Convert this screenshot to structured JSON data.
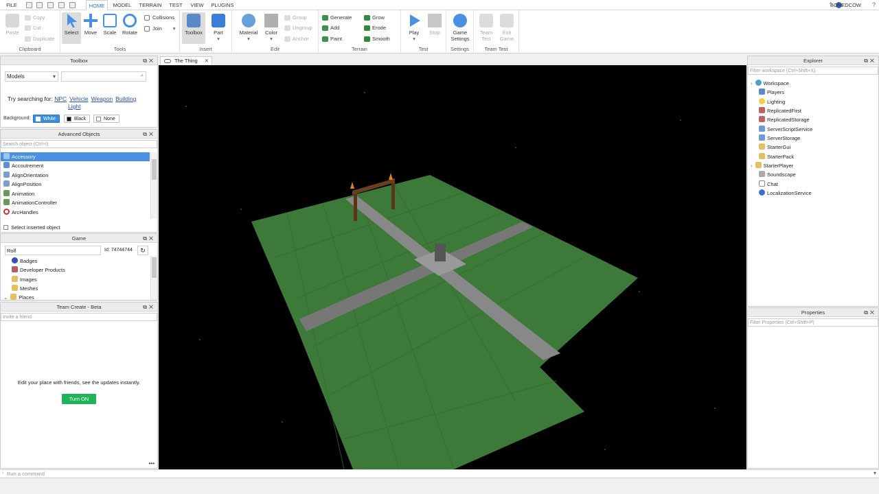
{
  "menubar": {
    "file": "FILE",
    "tabs": [
      "HOME",
      "MODEL",
      "TERRAIN",
      "TEST",
      "VIEW",
      "PLUGINS"
    ],
    "active_tab": "HOME",
    "username": "BOREDCOW"
  },
  "ribbon": {
    "clipboard": {
      "label": "Clipboard",
      "paste": "Paste",
      "copy": "Copy",
      "cut": "Cut",
      "duplicate": "Duplicate"
    },
    "tools": {
      "label": "Tools",
      "select": "Select",
      "move": "Move",
      "scale": "Scale",
      "rotate": "Rotate",
      "collisions": "Collisions",
      "join": "Join"
    },
    "insert": {
      "label": "Insert",
      "toolbox": "Toolbox",
      "part": "Part"
    },
    "edit": {
      "label": "Edit",
      "material": "Material",
      "color": "Color",
      "group": "Group",
      "ungroup": "Ungroup",
      "anchor": "Anchor"
    },
    "terrain": {
      "label": "Terrain",
      "generate": "Generate",
      "add": "Add",
      "paint": "Paint",
      "grow": "Grow",
      "erode": "Erode",
      "smooth": "Smooth"
    },
    "test": {
      "label": "Test",
      "play": "Play",
      "stop": "Stop"
    },
    "settings": {
      "label": "Settings",
      "game_settings_1": "Game",
      "game_settings_2": "Settings"
    },
    "team_test": {
      "label": "Team Test",
      "team_test_1": "Team",
      "team_test_2": "Test",
      "exit_game_1": "Exit",
      "exit_game_2": "Game"
    }
  },
  "toolbox": {
    "title": "Toolbox",
    "category": "Models",
    "try_label": "Try searching for:",
    "suggestions": [
      "NPC",
      "Vehicle",
      "Weapon",
      "Building",
      "Light"
    ],
    "background_label": "Background:",
    "bg_white": "White",
    "bg_black": "Black",
    "bg_none": "None"
  },
  "advanced_objects": {
    "title": "Advanced Objects",
    "search_placeholder": "Search object (Ctrl+I)",
    "items": [
      "Accessory",
      "Accoutrement",
      "AlignOrientation",
      "AlignPosition",
      "Animation",
      "AnimationController",
      "ArcHandles"
    ],
    "select_inserted": "Select inserted object"
  },
  "game": {
    "title": "Game",
    "name": "Rolf",
    "id": "Id: 74744744",
    "items": [
      "Badges",
      "Developer Products",
      "Images",
      "Meshes",
      "Places"
    ]
  },
  "team_create": {
    "title": "Team Create - Beta",
    "invite_placeholder": "Invite a friend",
    "message": "Edit your place with friends, see the updates instantly.",
    "turn_on": "Turn ON"
  },
  "document_tab": "The Thing",
  "explorer": {
    "title": "Explorer",
    "filter_placeholder": "Filter workspace (Ctrl+Shift+X)",
    "items": [
      "Workspace",
      "Players",
      "Lighting",
      "ReplicatedFirst",
      "ReplicatedStorage",
      "ServerScriptService",
      "ServerStorage",
      "StarterGui",
      "StarterPack",
      "StarterPlayer",
      "Soundscape",
      "Chat",
      "LocalizationService"
    ]
  },
  "properties": {
    "title": "Properties",
    "filter_placeholder": "Filter Properties (Ctrl+Shift+P)"
  },
  "command_bar": {
    "placeholder": "Run a command"
  },
  "colors": {
    "accent": "#2b6fd6",
    "selection": "#4a8fe0",
    "turn_on": "#1fb35a",
    "baseplate": "#3d7a3a"
  }
}
